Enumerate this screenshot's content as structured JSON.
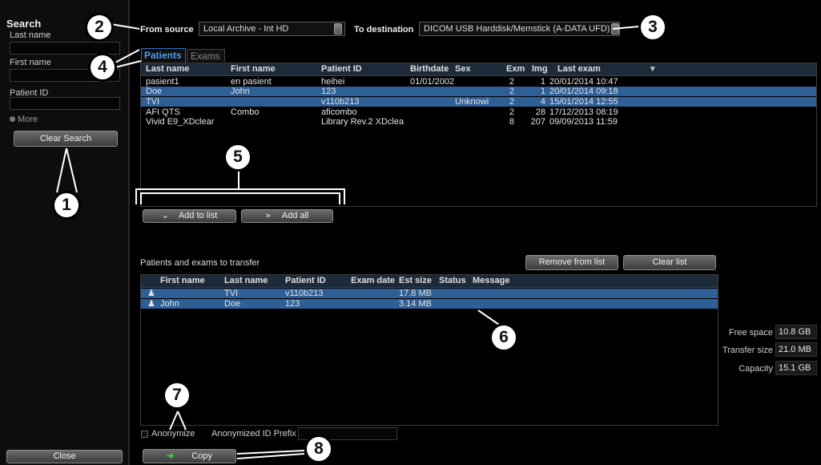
{
  "sidebar": {
    "title": "Search",
    "last_name_label": "Last name",
    "first_name_label": "First name",
    "patient_id_label": "Patient ID",
    "more_label": "More",
    "clear_search_label": "Clear Search",
    "close_label": "Close"
  },
  "toolbar": {
    "from_source_label": "From source",
    "from_source_value": "Local Archive - Int HD",
    "to_destination_label": "To destination",
    "to_destination_value": "DICOM USB Harddisk/Memstick (A-DATA UFD)"
  },
  "tabs": [
    {
      "label": "Patients",
      "selected": true
    },
    {
      "label": "Exams",
      "selected": false
    }
  ],
  "patients_table": {
    "columns": [
      "Last name",
      "First name",
      "Patient ID",
      "Birthdate",
      "Sex",
      "Exm",
      "Img",
      "Last exam"
    ],
    "rows": [
      {
        "last_name": "pasient1",
        "first_name": "en pasient",
        "patient_id": "heihei",
        "birthdate": "01/01/2002",
        "sex": "",
        "exm": "2",
        "img": "1",
        "last_exam": "20/01/2014 10:47",
        "selected": false
      },
      {
        "last_name": "Doe",
        "first_name": "John",
        "patient_id": "123",
        "birthdate": "",
        "sex": "",
        "exm": "2",
        "img": "1",
        "last_exam": "20/01/2014 09:18",
        "selected": true
      },
      {
        "last_name": "TVI",
        "first_name": "",
        "patient_id": "v110b213",
        "birthdate": "",
        "sex": "Unknowi",
        "exm": "2",
        "img": "4",
        "last_exam": "15/01/2014 12:55",
        "selected": true
      },
      {
        "last_name": "AFI QTS",
        "first_name": "Combo",
        "patient_id": "aficombo",
        "birthdate": "",
        "sex": "",
        "exm": "2",
        "img": "28",
        "last_exam": "17/12/2013 08:19",
        "selected": false
      },
      {
        "last_name": "Vivid E9_XDclear",
        "first_name": "",
        "patient_id": "Library Rev.2 XDclea",
        "birthdate": "",
        "sex": "",
        "exm": "8",
        "img": "207",
        "last_exam": "09/09/2013 11:59",
        "selected": false
      }
    ]
  },
  "actions": {
    "add_to_list_label": "Add to list",
    "add_all_label": "Add all"
  },
  "transfer": {
    "title": "Patients and exams to transfer",
    "remove_from_list_label": "Remove from list",
    "clear_list_label": "Clear list",
    "columns": [
      "First name",
      "Last name",
      "Patient ID",
      "Exam date",
      "Est size",
      "Status",
      "Message"
    ],
    "rows": [
      {
        "first_name": "",
        "last_name": "TVI",
        "patient_id": "v110b213",
        "exam_date": "",
        "est_size": "17.8 MB",
        "status": "",
        "message": ""
      },
      {
        "first_name": "John",
        "last_name": "Doe",
        "patient_id": "123",
        "exam_date": "",
        "est_size": "3.14 MB",
        "status": "",
        "message": ""
      }
    ]
  },
  "stats": {
    "free_space_label": "Free space",
    "free_space_value": "10.8 GB",
    "transfer_size_label": "Transfer size",
    "transfer_size_value": "21.0 MB",
    "capacity_label": "Capacity",
    "capacity_value": "15.1 GB"
  },
  "bottom": {
    "anonymize_label": "Anonymize",
    "anonymized_id_prefix_label": "Anonymized ID Prefix",
    "copy_label": "Copy"
  },
  "callouts": [
    "1",
    "2",
    "3",
    "4",
    "5",
    "6",
    "7",
    "8"
  ],
  "colors": {
    "selection": "#2e5f96",
    "tab_accent": "#2a6fc0",
    "copy_arrow": "#3fcf4a"
  }
}
